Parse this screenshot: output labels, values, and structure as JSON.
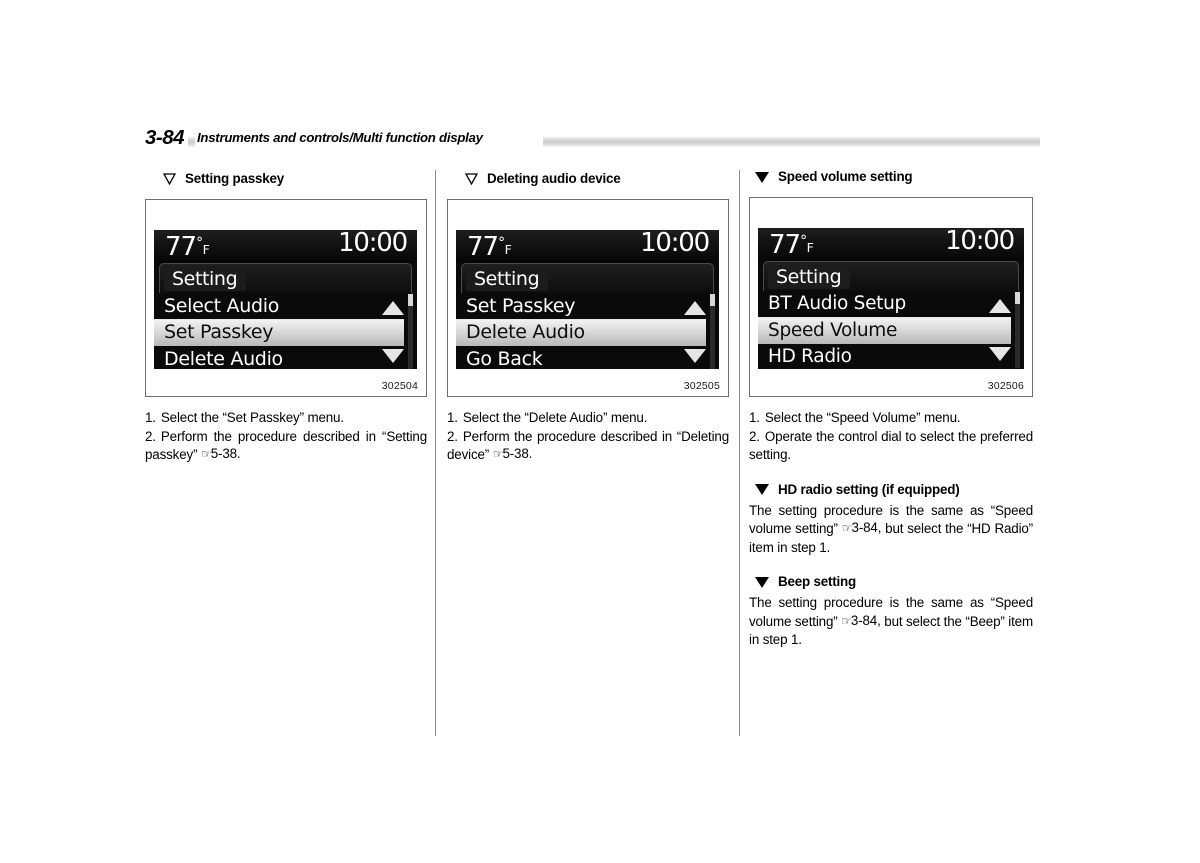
{
  "header": {
    "page_number": "3-84",
    "title": "Instruments and controls/Multi function display"
  },
  "columns": [
    {
      "heading": "Setting passkey",
      "heading_marker": "triangle-outline",
      "figure_id": "302504",
      "display": {
        "temperature": "77",
        "degree_symbol": "°",
        "unit": "F",
        "clock": "10:00",
        "title": "Setting",
        "items": [
          {
            "label": "Select Audio",
            "selected": false
          },
          {
            "label": "Set Passkey",
            "selected": true
          },
          {
            "label": "Delete Audio",
            "selected": false
          }
        ]
      },
      "steps": [
        {
          "num": "1.",
          "text": "Select the “Set Passkey” menu."
        },
        {
          "num": "2.",
          "pre": "Perform the procedure described in “Setting passkey” ",
          "ref": "5-38."
        }
      ]
    },
    {
      "heading": "Deleting audio device",
      "heading_marker": "triangle-outline",
      "figure_id": "302505",
      "display": {
        "temperature": "77",
        "degree_symbol": "°",
        "unit": "F",
        "clock": "10:00",
        "title": "Setting",
        "items": [
          {
            "label": "Set Passkey",
            "selected": false
          },
          {
            "label": "Delete Audio",
            "selected": true
          },
          {
            "label": "Go Back",
            "selected": false
          }
        ]
      },
      "steps": [
        {
          "num": "1.",
          "text": "Select the “Delete Audio” menu."
        },
        {
          "num": "2.",
          "pre": "Perform the procedure described in “Deleting device” ",
          "ref": "5-38."
        }
      ]
    },
    {
      "heading": "Speed volume setting",
      "heading_marker": "triangle-solid",
      "figure_id": "302506",
      "display": {
        "temperature": "77",
        "degree_symbol": "°",
        "unit": "F",
        "clock": "10:00",
        "title": "Setting",
        "items": [
          {
            "label": "BT Audio Setup",
            "selected": false
          },
          {
            "label": "Speed Volume",
            "selected": true
          },
          {
            "label": "HD Radio",
            "selected": false
          }
        ]
      },
      "steps": [
        {
          "num": "1.",
          "text": "Select the “Speed Volume” menu."
        },
        {
          "num": "2.",
          "text": "Operate the control dial to select the preferred setting."
        }
      ],
      "subsections": [
        {
          "heading": "HD radio setting (if equipped)",
          "heading_marker": "triangle-solid",
          "pre": "The setting procedure is the same as “Speed volume setting” ",
          "ref": "3-84,",
          "post": " but select the “HD Radio” item in step 1."
        },
        {
          "heading": "Beep setting",
          "heading_marker": "triangle-solid",
          "pre": "The setting procedure is the same as “Speed volume setting” ",
          "ref": "3-84,",
          "post": " but select the “Beep” item in step 1."
        }
      ]
    }
  ],
  "icons": {
    "hand_reference": "☞"
  }
}
